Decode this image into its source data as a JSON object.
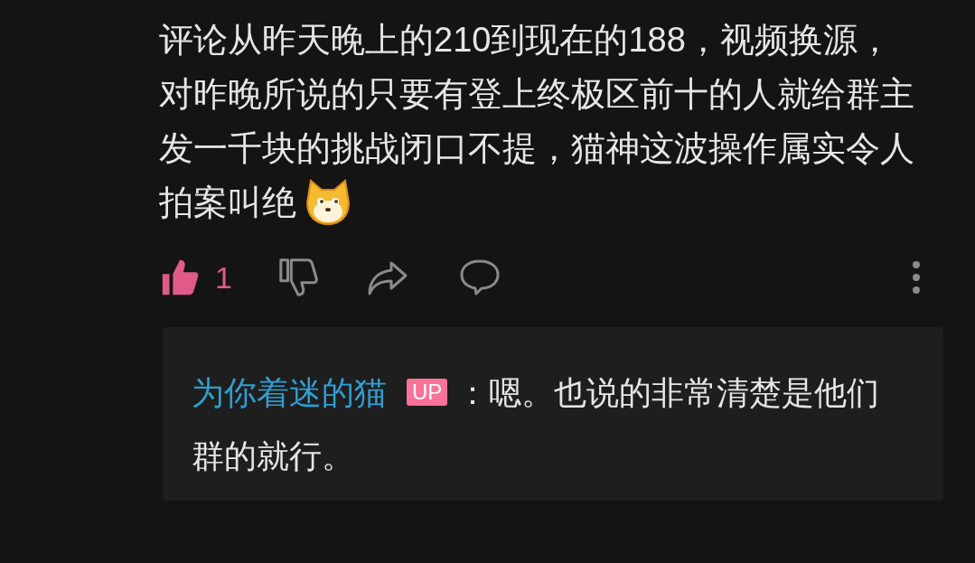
{
  "comment": {
    "text": "评论从昨天晚上的210到现在的188，视频换源，对昨晚所说的只要有登上终极区前十的人就给群主发一千块的挑战闭口不提，猫神这波操作属实令人拍案叫绝",
    "liked": true,
    "like_count": "1"
  },
  "reply": {
    "author": "为你着迷的猫",
    "badge": "UP",
    "separator": "：",
    "text": "嗯。也说的非常清楚是他们群的就行。"
  }
}
